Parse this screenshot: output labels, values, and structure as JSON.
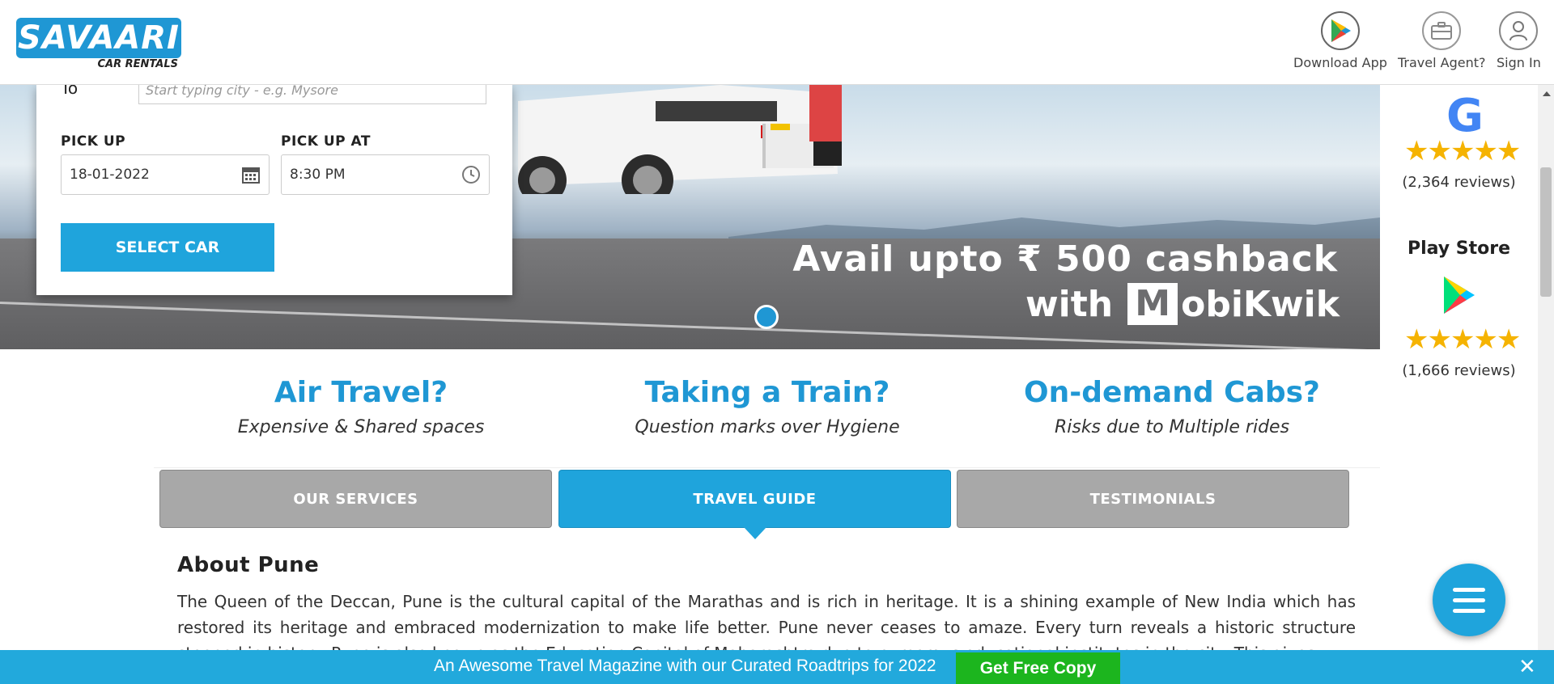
{
  "header": {
    "logo_text": "SAVAARI",
    "logo_sub": "CAR RENTALS",
    "download_app": "Download App",
    "travel_agent": "Travel Agent?",
    "sign_in": "Sign In"
  },
  "form": {
    "to_label": "To",
    "to_placeholder": "Start typing city - e.g. Mysore",
    "pickup_label": "PICK UP",
    "pickup_date": "18-01-2022",
    "pickup_at_label": "PICK UP AT",
    "pickup_time": "8:30 PM",
    "select_car": "SELECT CAR"
  },
  "hero": {
    "promo_line1": "Avail upto ₹ 500 cashback",
    "promo_with": "with",
    "promo_brand": "obiKwik",
    "promo_brand_m": "M"
  },
  "ratings": {
    "google_logo": "G",
    "google_stars": "★★★★★",
    "google_reviews": "(2,364 reviews)",
    "playstore_title": "Play Store",
    "playstore_stars": "★★★★★",
    "playstore_reviews": "(1,666 reviews)"
  },
  "features": [
    {
      "title": "Air Travel?",
      "subtitle": "Expensive & Shared spaces"
    },
    {
      "title": "Taking a Train?",
      "subtitle": "Question marks over Hygiene"
    },
    {
      "title": "On-demand Cabs?",
      "subtitle": "Risks due to Multiple rides"
    }
  ],
  "tabs": [
    {
      "label": "OUR SERVICES",
      "active": false
    },
    {
      "label": "TRAVEL GUIDE",
      "active": true
    },
    {
      "label": "TESTIMONIALS",
      "active": false
    }
  ],
  "about": {
    "title": "About Pune",
    "text": "The Queen of the Deccan, Pune is the cultural capital of the Marathas and is rich in heritage. It is a shining example of New India which has restored its heritage and embraced modernization to make life better. Pune never ceases to amaze. Every turn reveals a historic structure steeped in history. Pune is also known as the Education Capital of Maharashtra due to numerous educational institutes in the city. This gives"
  },
  "banner": {
    "text": "An Awesome Travel Magazine with our Curated Roadtrips for 2022",
    "button": "Get Free Copy",
    "close": "✕"
  },
  "colors": {
    "brand_blue": "#1f97d4",
    "tab_active": "#1fa4dc",
    "tab_inactive": "#a8a8a8",
    "banner_bg": "#22a9dc",
    "banner_button": "#1cb51e",
    "star": "#f5b301"
  }
}
